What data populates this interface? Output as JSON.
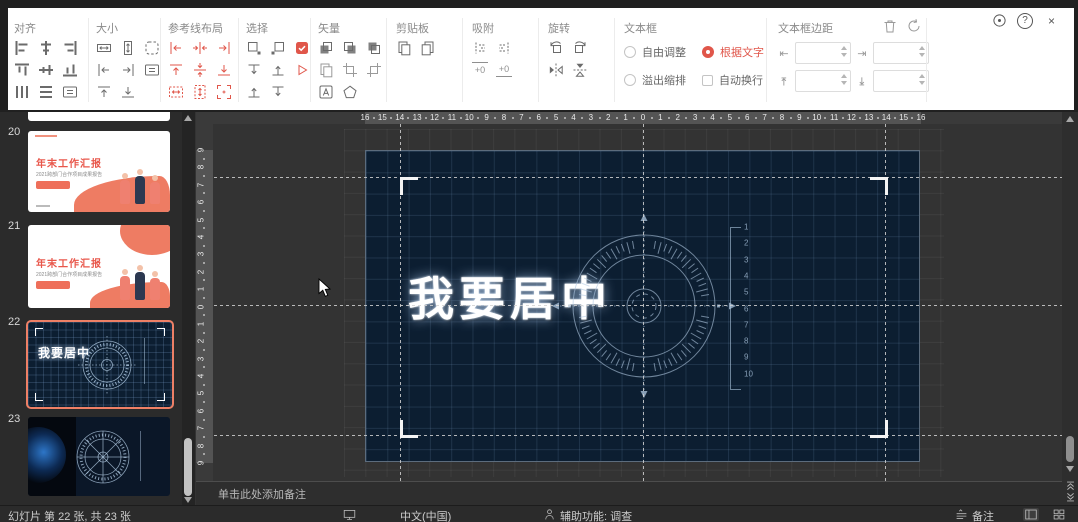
{
  "window": {
    "controls": {
      "help": "?",
      "close": "×"
    }
  },
  "ribbon": {
    "groups": [
      {
        "id": "align",
        "label": "对齐"
      },
      {
        "id": "size",
        "label": "大小"
      },
      {
        "id": "guides",
        "label": "参考线布局"
      },
      {
        "id": "select",
        "label": "选择"
      },
      {
        "id": "vector",
        "label": "矢量"
      },
      {
        "id": "clipboard",
        "label": "剪贴板"
      },
      {
        "id": "snap",
        "label": "吸附"
      },
      {
        "id": "rotate",
        "label": "旋转"
      },
      {
        "id": "textbox",
        "label": "文本框"
      },
      {
        "id": "margin",
        "label": "文本框边距"
      }
    ],
    "snap_labels": [
      "+0",
      "+0"
    ],
    "textbox_options": [
      {
        "label": "自由调整",
        "type": "radio",
        "checked": false
      },
      {
        "label": "溢出缩排",
        "type": "radio",
        "checked": false
      },
      {
        "label": "根据文字",
        "type": "radio",
        "checked": true
      },
      {
        "label": "自动换行",
        "type": "checkbox",
        "checked": false
      }
    ]
  },
  "slides": [
    {
      "number": "20",
      "title": "年末工作汇报",
      "subtitle": "2021跨部门合作项目成果报告",
      "selected": false
    },
    {
      "number": "21",
      "title": "年末工作汇报",
      "subtitle": "2021跨部门合作项目成果报告",
      "selected": false
    },
    {
      "number": "22",
      "text": "我要居中",
      "selected": true
    },
    {
      "number": "23",
      "selected": false
    }
  ],
  "slide": {
    "text": "我要居中",
    "scale_numbers": [
      "1",
      "2",
      "3",
      "4",
      "5",
      "6",
      "7",
      "8",
      "9",
      "10"
    ]
  },
  "rulers": {
    "h_max": 16,
    "v_max": 9
  },
  "notes": {
    "placeholder": "单击此处添加备注"
  },
  "statusbar": {
    "slide_info": "幻灯片 第 22 张, 共 23 张",
    "language": "中文(中国)",
    "accessibility": "辅助功能: 调查",
    "notes_label": "备注"
  },
  "colors": {
    "accent_red": "#e0564a",
    "salmon": "#ee7c63",
    "slide_bg": "#0c1e31"
  }
}
